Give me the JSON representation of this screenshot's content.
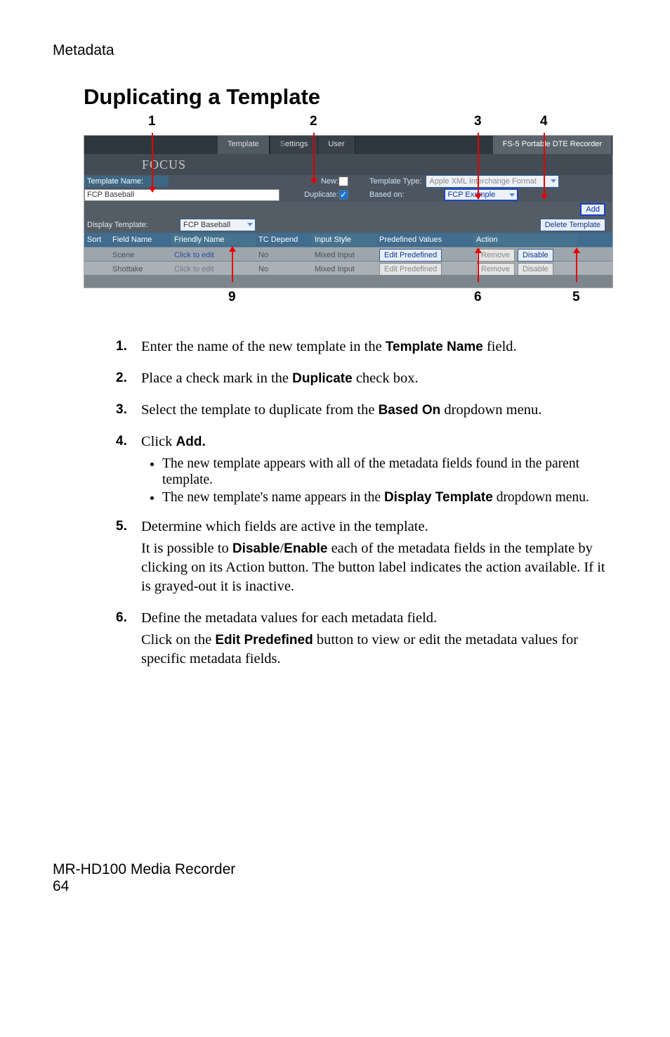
{
  "header": "Metadata",
  "title": "Duplicating a Template",
  "callouts_top": {
    "c1": "1",
    "c2": "2",
    "c3": "3",
    "c4": "4"
  },
  "callouts_bottom": {
    "c9": "9",
    "c6": "6",
    "c5": "5"
  },
  "ui": {
    "tabs": {
      "template": "Template",
      "settings_partial": "ettings",
      "user": "User"
    },
    "banner": "FS-5 Portable DTE Recorder",
    "logo": "FOCUS",
    "templateName_label": "Template Name:",
    "templateName_value": "FCP Baseball",
    "new_label": "New:",
    "duplicate_label": "Duplicate:",
    "check_checked": "✓",
    "templateType_label": "Template Type:",
    "templateType_value": "Apple XML Interchange Format",
    "basedOn_label": "Based on:",
    "basedOn_value": "FCP Example",
    "add_btn": "Add",
    "displayTemplate_label": "Display Template:",
    "displayTemplate_value": "FCP Baseball",
    "deleteTemplate_btn": "Delete Template",
    "headers": {
      "sort": "Sort",
      "field": "Field Name",
      "friendly": "Friendly Name",
      "tc": "TC Depend",
      "input": "Input Style",
      "pre": "Predefined Values",
      "action": "Action"
    },
    "rows": [
      {
        "field": "Scene",
        "friendly": "Click to edit",
        "tc": "No",
        "input": "Mixed Input",
        "pre": "Edit Predefined",
        "remove": "Remove",
        "toggle": "Disable"
      },
      {
        "field": "Shottake",
        "friendly": "Click to edit",
        "tc": "No",
        "input": "Mixed Input",
        "pre": "Edit Predefined",
        "remove": "Remove",
        "toggle": "Disable"
      }
    ]
  },
  "steps": [
    {
      "n": "1.",
      "body": [
        {
          "t": "text",
          "v": "Enter the name of the new template in the "
        },
        {
          "t": "bold",
          "v": "Template Name"
        },
        {
          "t": "text",
          "v": " field."
        }
      ]
    },
    {
      "n": "2.",
      "body": [
        {
          "t": "text",
          "v": "Place a check mark in the "
        },
        {
          "t": "bold",
          "v": "Duplicate"
        },
        {
          "t": "text",
          "v": " check box."
        }
      ]
    },
    {
      "n": "3.",
      "body": [
        {
          "t": "text",
          "v": "Select the template to duplicate from the "
        },
        {
          "t": "bold",
          "v": "Based On"
        },
        {
          "t": "text",
          "v": " dropdown menu."
        }
      ]
    },
    {
      "n": "4.",
      "body": [
        {
          "t": "text",
          "v": "Click "
        },
        {
          "t": "bold",
          "v": "Add."
        }
      ],
      "bullets": [
        [
          {
            "t": "text",
            "v": "The new template appears with all of the metadata fields found in the parent template."
          }
        ],
        [
          {
            "t": "text",
            "v": "The new template's name appears in the "
          },
          {
            "t": "bold",
            "v": "Display Template"
          },
          {
            "t": "text",
            "v": " dropdown menu."
          }
        ]
      ]
    },
    {
      "n": "5.",
      "body": [
        {
          "t": "text",
          "v": "Determine which fields are active in the template."
        }
      ],
      "para2": [
        {
          "t": "text",
          "v": "It is possible to "
        },
        {
          "t": "bold",
          "v": "Disable"
        },
        {
          "t": "text",
          "v": "/"
        },
        {
          "t": "bold",
          "v": "Enable"
        },
        {
          "t": "text",
          "v": " each of the metadata fields in the template by clicking on its Action button. The button label indicates the action available. If it is grayed-out it is inactive."
        }
      ]
    },
    {
      "n": "6.",
      "body": [
        {
          "t": "text",
          "v": "Define the metadata values for each metadata field."
        }
      ],
      "para2": [
        {
          "t": "text",
          "v": "Click on the "
        },
        {
          "t": "bold",
          "v": "Edit Predefined"
        },
        {
          "t": "text",
          "v": " button to view or edit the metadata values for specific metadata fields."
        }
      ]
    }
  ],
  "footer": {
    "line1": "MR-HD100 Media Recorder",
    "line2": "64"
  }
}
